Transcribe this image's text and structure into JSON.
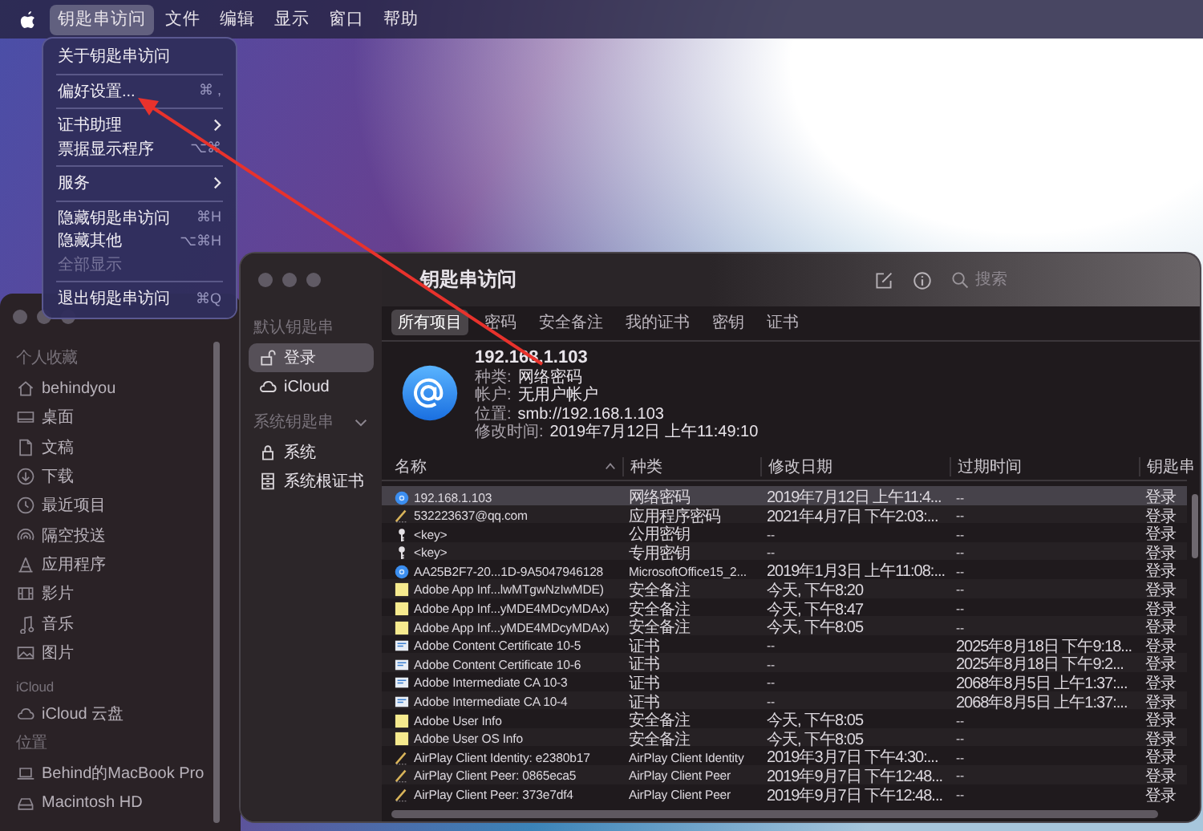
{
  "menu_bar": {
    "items": [
      {
        "label": "钥匙串访问",
        "selected": true
      },
      {
        "label": "文件",
        "selected": false
      },
      {
        "label": "编辑",
        "selected": false
      },
      {
        "label": "显示",
        "selected": false
      },
      {
        "label": "窗口",
        "selected": false
      },
      {
        "label": "帮助",
        "selected": false
      }
    ]
  },
  "app_menu": {
    "items": [
      {
        "kind": "item",
        "label": "关于钥匙串访问",
        "submenu": false,
        "disabled": false
      },
      {
        "kind": "separator"
      },
      {
        "kind": "item",
        "label": "偏好设置...",
        "shortcut": "⌘ ,",
        "submenu": false,
        "disabled": false
      },
      {
        "kind": "separator"
      },
      {
        "kind": "item",
        "label": "证书助理",
        "submenu": true,
        "disabled": false
      },
      {
        "kind": "item",
        "label": "票据显示程序",
        "shortcut": "⌥⌘",
        "submenu": false,
        "disabled": false
      },
      {
        "kind": "separator"
      },
      {
        "kind": "item",
        "label": "服务",
        "submenu": true,
        "disabled": false
      },
      {
        "kind": "separator"
      },
      {
        "kind": "item",
        "label": "隐藏钥匙串访问",
        "shortcut": "⌘H",
        "submenu": false,
        "disabled": false
      },
      {
        "kind": "item",
        "label": "隐藏其他",
        "shortcut": "⌥⌘H",
        "submenu": false,
        "disabled": false
      },
      {
        "kind": "item",
        "label": "全部显示",
        "submenu": false,
        "disabled": true
      },
      {
        "kind": "separator"
      },
      {
        "kind": "item",
        "label": "退出钥匙串访问",
        "shortcut": "⌘Q",
        "submenu": false,
        "disabled": false
      }
    ]
  },
  "finder_sidebar": {
    "sections": [
      {
        "title": "个人收藏",
        "items": [
          {
            "kind": "home",
            "label": "behindyou"
          },
          {
            "kind": "desktop",
            "label": "桌面"
          },
          {
            "kind": "document",
            "label": "文稿"
          },
          {
            "kind": "download",
            "label": "下载"
          },
          {
            "kind": "recent",
            "label": "最近项目"
          },
          {
            "kind": "airdrop",
            "label": "隔空投送"
          },
          {
            "kind": "apps",
            "label": "应用程序"
          },
          {
            "kind": "movies",
            "label": "影片"
          },
          {
            "kind": "music",
            "label": "音乐"
          },
          {
            "kind": "pictures",
            "label": "图片"
          }
        ]
      },
      {
        "title": "iCloud",
        "items": [
          {
            "kind": "cloud",
            "label": "iCloud 云盘"
          }
        ]
      },
      {
        "title": "位置",
        "items": [
          {
            "kind": "laptop",
            "label": "Behind的MacBook Pro"
          },
          {
            "kind": "disk",
            "label": "Macintosh HD"
          }
        ]
      }
    ]
  },
  "keychain_window": {
    "title": "钥匙串访问",
    "search": {
      "placeholder": "搜索"
    },
    "sidebar": {
      "sections": [
        {
          "title": "默认钥匙串",
          "collapsible": false,
          "items": [
            {
              "kind": "lock-open",
              "label": "登录",
              "selected": true
            },
            {
              "kind": "cloud",
              "label": "iCloud",
              "selected": false
            }
          ]
        },
        {
          "title": "系统钥匙串",
          "collapsible": true,
          "items": [
            {
              "kind": "lock",
              "label": "系统",
              "selected": false
            },
            {
              "kind": "cabinet",
              "label": "系统根证书",
              "selected": false
            }
          ]
        }
      ]
    },
    "tabs": [
      {
        "label": "所有项目",
        "selected": true
      },
      {
        "label": "密码",
        "selected": false
      },
      {
        "label": "安全备注",
        "selected": false
      },
      {
        "label": "我的证书",
        "selected": false
      },
      {
        "label": "密钥",
        "selected": false
      },
      {
        "label": "证书",
        "selected": false
      }
    ],
    "detail": {
      "name": "192.168.1.103",
      "fields": [
        {
          "label": "种类:",
          "value": "网络密码"
        },
        {
          "label": "帐户:",
          "value": "无用户帐户"
        },
        {
          "label": "位置:",
          "value": "smb://192.168.1.103"
        },
        {
          "label": "修改时间:",
          "value": "2019年7月12日 上午11:49:10"
        }
      ]
    },
    "table": {
      "columns": [
        {
          "label": "名称",
          "sorted": true
        },
        {
          "label": "种类",
          "sorted": false
        },
        {
          "label": "修改日期",
          "sorted": false
        },
        {
          "label": "过期时间",
          "sorted": false
        },
        {
          "label": "钥匙串",
          "sorted": false
        }
      ],
      "rows": [
        {
          "kind": "internet",
          "name": "192.168.1.103",
          "type": "网络密码",
          "modified": "2019年7月12日 上午11:4...",
          "expires": "--",
          "keychain": "登录",
          "selected": true
        },
        {
          "kind": "app",
          "name": "532223637@qq.com",
          "type": "应用程序密码",
          "modified": "2021年4月7日 下午2:03:...",
          "expires": "--",
          "keychain": "登录",
          "selected": false
        },
        {
          "kind": "key",
          "name": "<key>",
          "type": "公用密钥",
          "modified": "--",
          "expires": "--",
          "keychain": "登录",
          "selected": false
        },
        {
          "kind": "key",
          "name": "<key>",
          "type": "专用密钥",
          "modified": "--",
          "expires": "--",
          "keychain": "登录",
          "selected": false
        },
        {
          "kind": "internet",
          "name": "AA25B2F7-20...1D-9A5047946128",
          "type": "MicrosoftOffice15_2...",
          "modified": "2019年1月3日 上午11:08:...",
          "expires": "--",
          "keychain": "登录",
          "selected": false
        },
        {
          "kind": "note",
          "name": "Adobe App Inf...lwMTgwNzIwMDE)",
          "type": "安全备注",
          "modified": "今天, 下午8:20",
          "expires": "--",
          "keychain": "登录",
          "selected": false
        },
        {
          "kind": "note",
          "name": "Adobe App Inf...yMDE4MDcyMDAx)",
          "type": "安全备注",
          "modified": "今天, 下午8:47",
          "expires": "--",
          "keychain": "登录",
          "selected": false
        },
        {
          "kind": "note",
          "name": "Adobe App Inf...yMDE4MDcyMDAx)",
          "type": "安全备注",
          "modified": "今天, 下午8:05",
          "expires": "--",
          "keychain": "登录",
          "selected": false
        },
        {
          "kind": "certificate",
          "name": "Adobe Content Certificate 10-5",
          "type": "证书",
          "modified": "--",
          "expires": "2025年8月18日 下午9:18...",
          "keychain": "登录",
          "selected": false
        },
        {
          "kind": "certificate",
          "name": "Adobe Content Certificate 10-6",
          "type": "证书",
          "modified": "--",
          "expires": "2025年8月18日 下午9:2...",
          "keychain": "登录",
          "selected": false
        },
        {
          "kind": "certificate",
          "name": "Adobe Intermediate CA 10-3",
          "type": "证书",
          "modified": "--",
          "expires": "2068年8月5日 上午1:37:...",
          "keychain": "登录",
          "selected": false
        },
        {
          "kind": "certificate",
          "name": "Adobe Intermediate CA 10-4",
          "type": "证书",
          "modified": "--",
          "expires": "2068年8月5日 上午1:37:...",
          "keychain": "登录",
          "selected": false
        },
        {
          "kind": "note",
          "name": "Adobe User Info",
          "type": "安全备注",
          "modified": "今天, 下午8:05",
          "expires": "--",
          "keychain": "登录",
          "selected": false
        },
        {
          "kind": "note",
          "name": "Adobe User OS Info",
          "type": "安全备注",
          "modified": "今天, 下午8:05",
          "expires": "--",
          "keychain": "登录",
          "selected": false
        },
        {
          "kind": "app",
          "name": "AirPlay Client Identity: e2380b17",
          "type": "AirPlay Client Identity",
          "modified": "2019年3月7日 下午4:30:...",
          "expires": "--",
          "keychain": "登录",
          "selected": false
        },
        {
          "kind": "app",
          "name": "AirPlay Client Peer: 0865eca5",
          "type": "AirPlay Client Peer",
          "modified": "2019年9月7日 下午12:48...",
          "expires": "--",
          "keychain": "登录",
          "selected": false
        },
        {
          "kind": "app",
          "name": "AirPlay Client Peer: 373e7df4",
          "type": "AirPlay Client Peer",
          "modified": "2019年9月7日 下午12:48...",
          "expires": "--",
          "keychain": "登录",
          "selected": false
        }
      ]
    }
  }
}
